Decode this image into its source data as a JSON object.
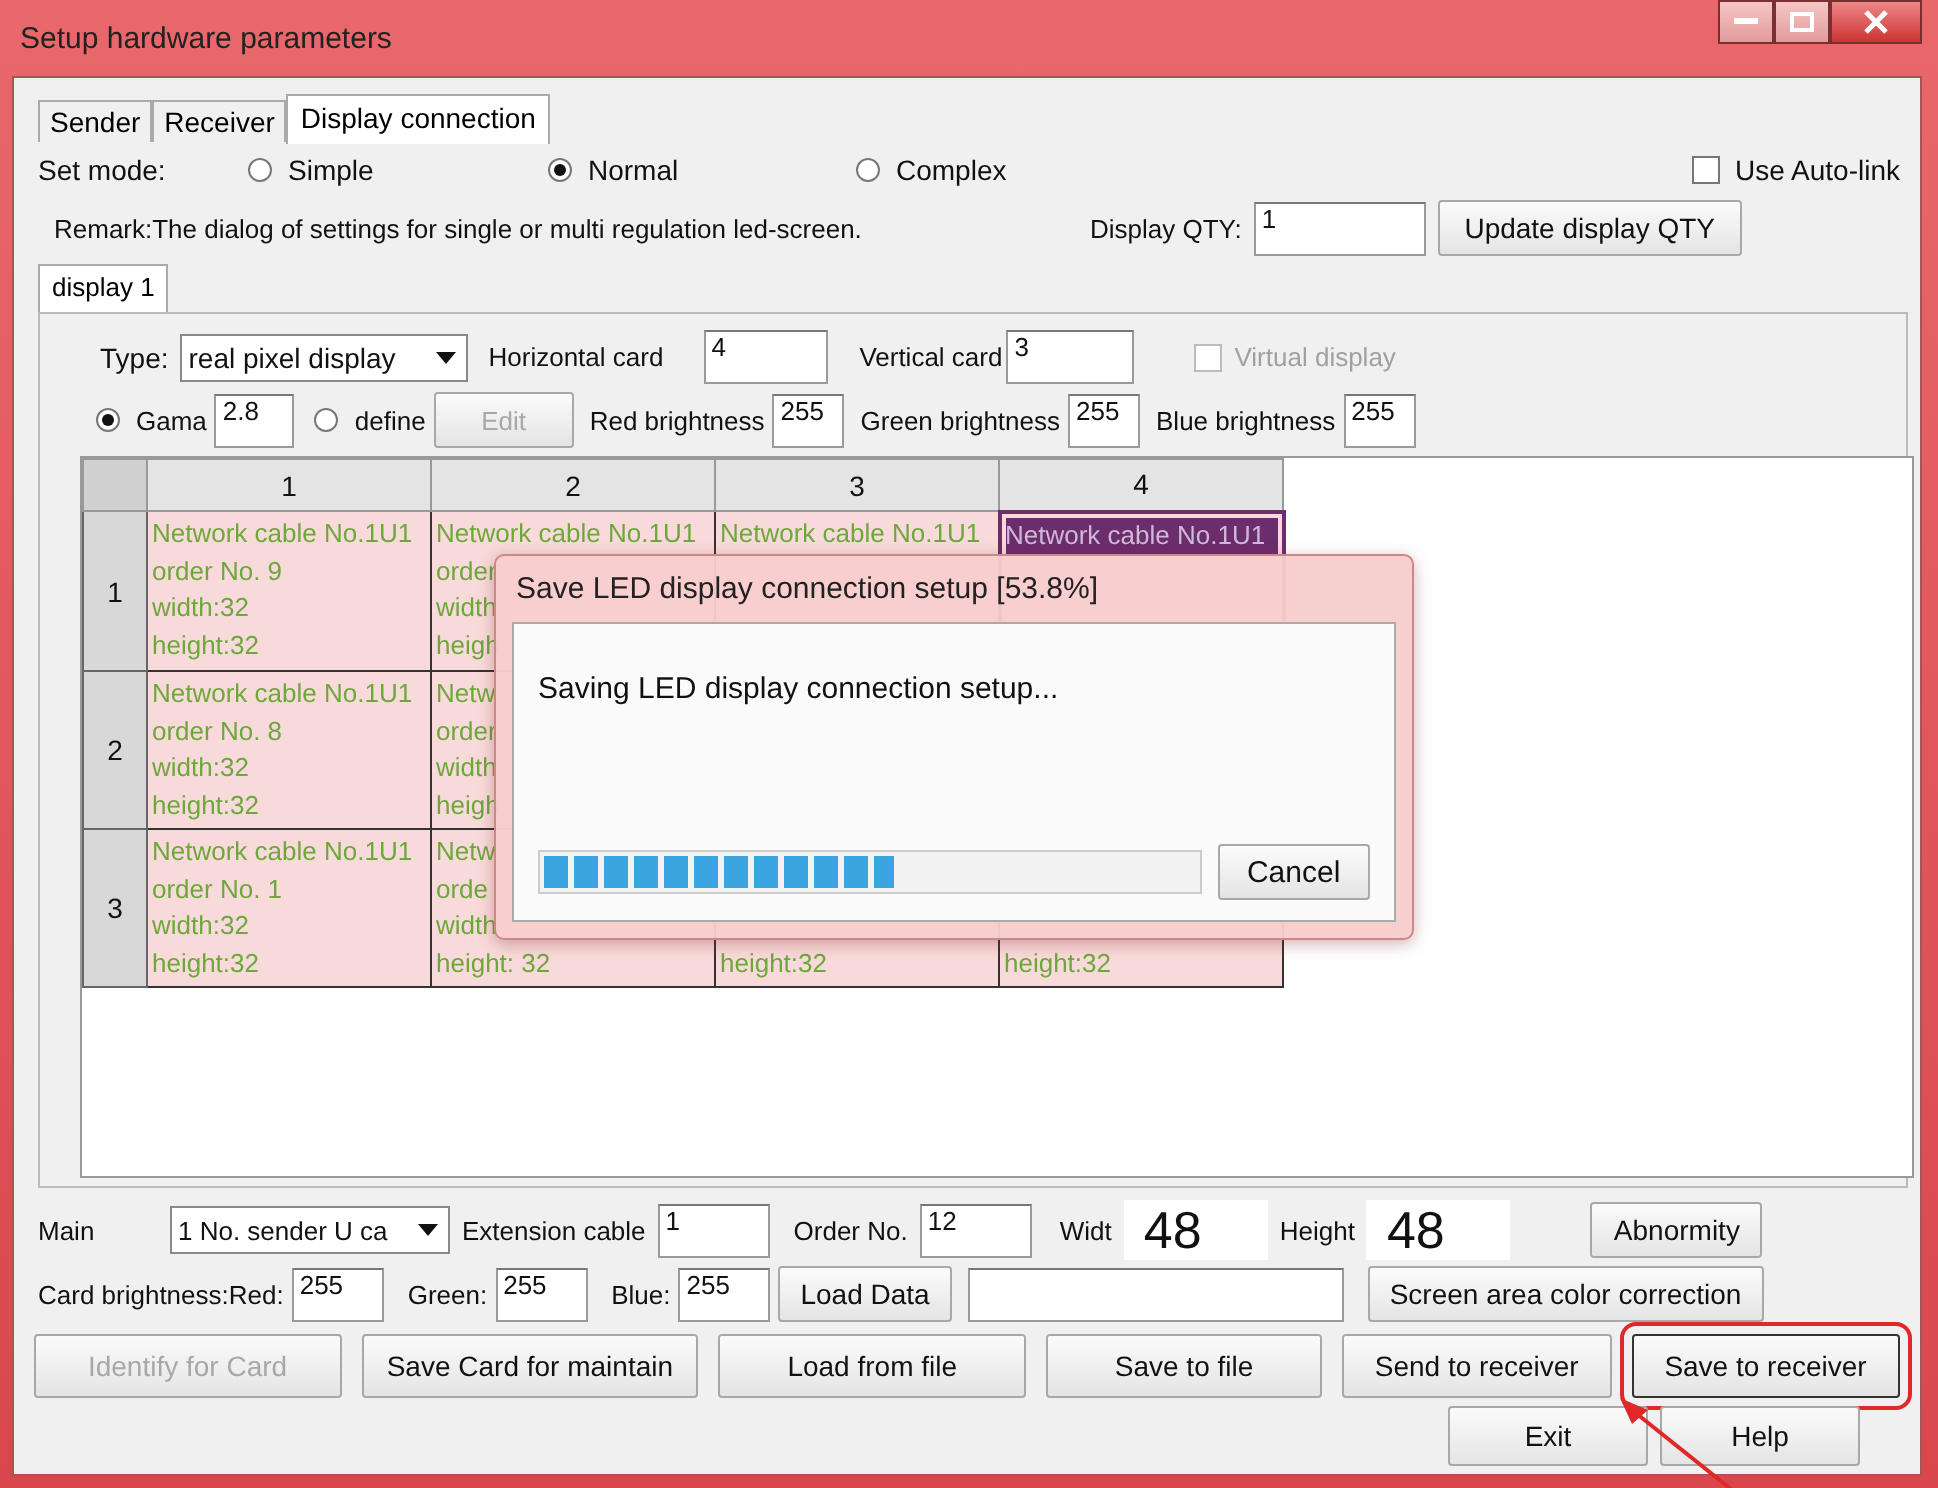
{
  "window": {
    "title": "Setup hardware parameters"
  },
  "tabs": [
    {
      "label": "Sender",
      "selected": false
    },
    {
      "label": "Receiver",
      "selected": false
    },
    {
      "label": "Display connection",
      "selected": true
    }
  ],
  "set_mode": {
    "label": "Set mode:",
    "options": [
      {
        "label": "Simple",
        "selected": false
      },
      {
        "label": "Normal",
        "selected": true
      },
      {
        "label": "Complex",
        "selected": false
      }
    ]
  },
  "auto_link": {
    "label": "Use Auto-link",
    "checked": false
  },
  "remark": "Remark:The dialog of settings for single or multi  regulation led-screen.",
  "display_qty": {
    "label": "Display QTY:",
    "value": "1",
    "button": "Update display QTY"
  },
  "display_tabs": [
    {
      "label": "display 1",
      "selected": true
    }
  ],
  "type": {
    "label": "Type:",
    "value": "real pixel display"
  },
  "horizontal_card": {
    "label": "Horizontal card",
    "value": "4"
  },
  "vertical_card": {
    "label": "Vertical card",
    "value": "3"
  },
  "virtual_display": {
    "label": "Virtual display",
    "checked": false,
    "disabled": true
  },
  "gamma": {
    "label": "Gama",
    "selected": true,
    "value": "2.8"
  },
  "define": {
    "label": "define",
    "selected": false,
    "button": "Edit",
    "disabled": true
  },
  "brightness": [
    {
      "label": "Red brightness",
      "value": "255"
    },
    {
      "label": "Green brightness",
      "value": "255"
    },
    {
      "label": "Blue brightness",
      "value": "255"
    }
  ],
  "grid": {
    "columns": [
      "1",
      "2",
      "3",
      "4"
    ],
    "rows": [
      {
        "label": "1",
        "cells": [
          {
            "selected": false,
            "lines": [
              "Network cable No.1U1",
              "order No. 9",
              "width:32",
              "height:32"
            ]
          },
          {
            "selected": false,
            "lines": [
              "Network cable No.1U1",
              "order",
              "width",
              "heigh"
            ]
          },
          {
            "selected": false,
            "lines": [
              "Network cable No.1U1"
            ]
          },
          {
            "selected": true,
            "lines": [
              "Network cable No.1U1"
            ]
          }
        ]
      },
      {
        "label": "2",
        "cells": [
          {
            "selected": false,
            "lines": [
              "Network cable No.1U1",
              "order No. 8",
              "width:32",
              "height:32"
            ]
          },
          {
            "selected": false,
            "lines": [
              "Netw",
              "order",
              "width",
              "heigh"
            ]
          }
        ]
      },
      {
        "label": "3",
        "cells": [
          {
            "selected": false,
            "lines": [
              "Network cable No.1U1",
              "order No. 1",
              "width:32",
              "height:32"
            ]
          },
          {
            "selected": false,
            "lines": [
              "Netw",
              "orde",
              "width",
              "height: 32"
            ]
          },
          {
            "selected": false,
            "bottom_lines": [
              "height:32"
            ]
          },
          {
            "selected": false,
            "bottom_lines": [
              "height:32"
            ]
          }
        ]
      }
    ]
  },
  "dialog": {
    "title": "Save LED display connection setup [53.8%]",
    "message": "Saving LED display connection setup...",
    "level": 0.538,
    "button": "Cancel"
  },
  "main": {
    "label": "Main",
    "value": "1 No. sender U ca"
  },
  "extension_cable": {
    "label": "Extension cable",
    "value": "1"
  },
  "order_no": {
    "label": "Order No.",
    "value": "12"
  },
  "width": {
    "label": "Widt",
    "value": "48"
  },
  "height": {
    "label": "Height",
    "value": "48"
  },
  "abnormity_button": "Abnormity",
  "card_brightness": [
    {
      "label": "Card brightness:Red:",
      "value": "255"
    },
    {
      "label": "Green:",
      "value": "255"
    },
    {
      "label": "Blue:",
      "value": "255"
    }
  ],
  "load_data_button": "Load Data",
  "color_correction_button": "Screen area color correction",
  "actions": [
    {
      "label": "Identify for Card",
      "disabled": true,
      "highlighted": false
    },
    {
      "label": "Save Card for maintain",
      "disabled": false,
      "highlighted": false
    },
    {
      "label": "Load from file",
      "disabled": false,
      "highlighted": false
    },
    {
      "label": "Save to file",
      "disabled": false,
      "highlighted": false
    },
    {
      "label": "Send to receiver",
      "disabled": false,
      "highlighted": false
    },
    {
      "label": "Save to receiver",
      "disabled": false,
      "highlighted": true
    }
  ],
  "footer_buttons": [
    "Exit",
    "Help"
  ]
}
